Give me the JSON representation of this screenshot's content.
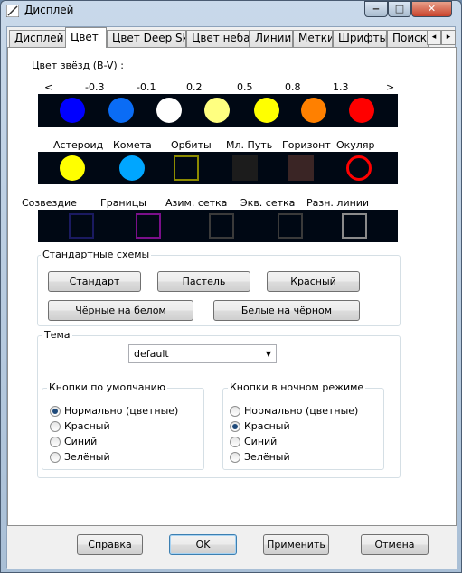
{
  "window": {
    "title": "Дисплей",
    "controls": {
      "minimize": "‒",
      "maximize": "□",
      "close": "✕"
    }
  },
  "tabs": [
    "Дисплей",
    "Цвет",
    "Цвет Deep Sky",
    "Цвет неба",
    "Линии",
    "Метки",
    "Шрифты",
    "Поиск"
  ],
  "active_tab": "Цвет",
  "tab_scroll": {
    "left": "◂",
    "right": "▸"
  },
  "star_colors": {
    "label": "Цвет звёзд (B-V) :",
    "scale": [
      "<",
      "-0.3",
      "-0.1",
      "0.2",
      "0.5",
      "0.8",
      "1.3",
      ">"
    ],
    "swatches": [
      "#0000ff",
      "#0a6cf5",
      "#ffffff",
      "#ffff80",
      "#ffff00",
      "#ff8000",
      "#ff0000"
    ]
  },
  "objects": [
    {
      "label": "Астероид",
      "shape": "circle",
      "color": "#ffff00"
    },
    {
      "label": "Комета",
      "shape": "circle",
      "color": "#00a6ff"
    },
    {
      "label": "Орбиты",
      "shape": "square",
      "color": "#8c8a00"
    },
    {
      "label": "Мл. Путь",
      "shape": "filled-square",
      "color": "#1c1c1c"
    },
    {
      "label": "Горизонт",
      "shape": "filled-square",
      "color": "#3a2525"
    },
    {
      "label": "Окуляр",
      "shape": "ring",
      "color": "#ff0000"
    }
  ],
  "lines": [
    {
      "label": "Созвездие",
      "color": "#1a1a60"
    },
    {
      "label": "Границы",
      "color": "#7a0f8a"
    },
    {
      "label": "Азим. сетка",
      "color": "#3a3a3a"
    },
    {
      "label": "Экв. сетка",
      "color": "#3a3a3a"
    },
    {
      "label": "Разн. линии",
      "color": "#8a8a8a"
    }
  ],
  "schemes": {
    "title": "Стандартные схемы",
    "buttons": [
      "Стандарт",
      "Пастель",
      "Красный",
      "Чёрные на белом",
      "Белые на чёрном"
    ]
  },
  "theme": {
    "title": "Тема",
    "selected": "default",
    "default_buttons": {
      "title": "Кнопки по умолчанию",
      "options": [
        "Нормально (цветные)",
        "Красный",
        "Синий",
        "Зелёный"
      ],
      "selected_index": 0
    },
    "night_buttons": {
      "title": "Кнопки в ночном режиме",
      "options": [
        "Нормально (цветные)",
        "Красный",
        "Синий",
        "Зелёный"
      ],
      "selected_index": 1
    }
  },
  "footer": {
    "help": "Справка",
    "ok": "OK",
    "apply": "Применить",
    "cancel": "Отмена"
  }
}
